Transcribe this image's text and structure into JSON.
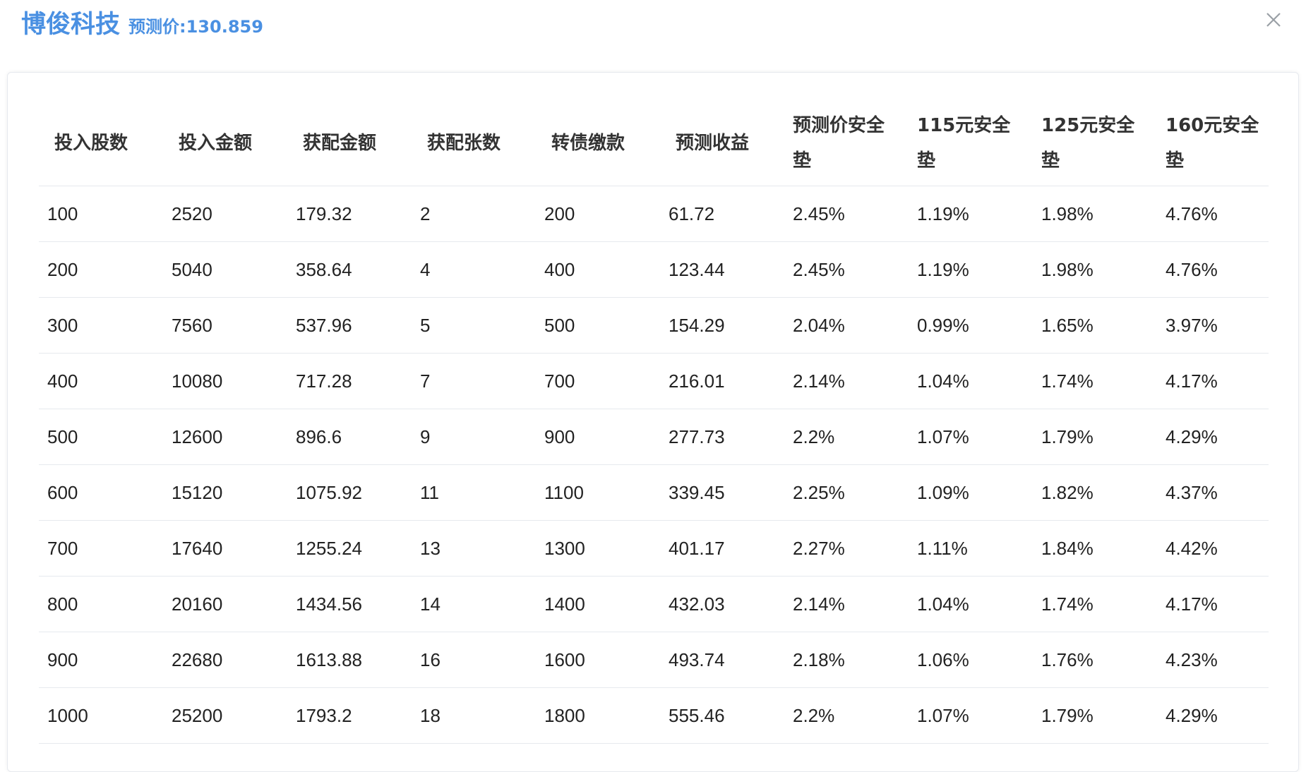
{
  "header": {
    "title": "博俊科技",
    "price_label": "预测价:130.859"
  },
  "close": {
    "icon": "close-icon"
  },
  "table": {
    "columns": [
      "投入股数",
      "投入金额",
      "获配金额",
      "获配张数",
      "转债缴款",
      "预测收益",
      "预测价安全垫",
      "115元安全垫",
      "125元安全垫",
      "160元安全垫"
    ],
    "rows": [
      [
        "100",
        "2520",
        "179.32",
        "2",
        "200",
        "61.72",
        "2.45%",
        "1.19%",
        "1.98%",
        "4.76%"
      ],
      [
        "200",
        "5040",
        "358.64",
        "4",
        "400",
        "123.44",
        "2.45%",
        "1.19%",
        "1.98%",
        "4.76%"
      ],
      [
        "300",
        "7560",
        "537.96",
        "5",
        "500",
        "154.29",
        "2.04%",
        "0.99%",
        "1.65%",
        "3.97%"
      ],
      [
        "400",
        "10080",
        "717.28",
        "7",
        "700",
        "216.01",
        "2.14%",
        "1.04%",
        "1.74%",
        "4.17%"
      ],
      [
        "500",
        "12600",
        "896.6",
        "9",
        "900",
        "277.73",
        "2.2%",
        "1.07%",
        "1.79%",
        "4.29%"
      ],
      [
        "600",
        "15120",
        "1075.92",
        "11",
        "1100",
        "339.45",
        "2.25%",
        "1.09%",
        "1.82%",
        "4.37%"
      ],
      [
        "700",
        "17640",
        "1255.24",
        "13",
        "1300",
        "401.17",
        "2.27%",
        "1.11%",
        "1.84%",
        "4.42%"
      ],
      [
        "800",
        "20160",
        "1434.56",
        "14",
        "1400",
        "432.03",
        "2.14%",
        "1.04%",
        "1.74%",
        "4.17%"
      ],
      [
        "900",
        "22680",
        "1613.88",
        "16",
        "1600",
        "493.74",
        "2.18%",
        "1.06%",
        "1.76%",
        "4.23%"
      ],
      [
        "1000",
        "25200",
        "1793.2",
        "18",
        "1800",
        "555.46",
        "2.2%",
        "1.07%",
        "1.79%",
        "4.29%"
      ]
    ]
  },
  "colors": {
    "accent": "#4a90e2",
    "text": "#222222",
    "border": "#e6e9ee"
  }
}
